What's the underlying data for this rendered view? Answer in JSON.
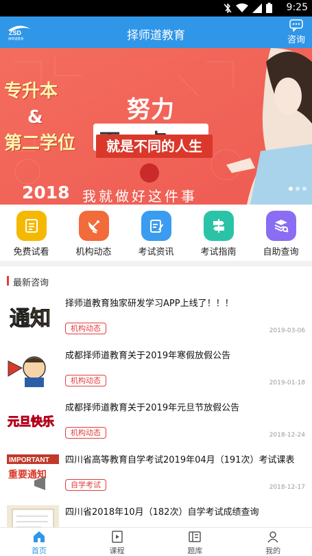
{
  "status_bar": {
    "time": "9:25",
    "icons": [
      "bluetooth-off-icon",
      "wifi-icon",
      "signal-icon",
      "battery-icon"
    ]
  },
  "header": {
    "title": "择师道教育",
    "consult_label": "咨询",
    "logo_text": "择师道教育",
    "brand_color": "#3096e8"
  },
  "banner": {
    "left_line1": "专升本",
    "left_line2": "&",
    "left_line3": "第二学位",
    "slogan_top": "努力",
    "slogan_main": "再一点",
    "slogan_sub": "就是不同的人生",
    "year": "2018",
    "script": "我就做好这件事",
    "seal_text": "ZSD",
    "active_slide": 0,
    "slide_count": 3
  },
  "quick_nav": [
    {
      "label": "免费试看",
      "icon": "video-doc-icon",
      "color": "#f5b800"
    },
    {
      "label": "机构动态",
      "icon": "satellite-dish-icon",
      "color": "#f26b3a"
    },
    {
      "label": "考试资讯",
      "icon": "edit-doc-icon",
      "color": "#3a9cf0"
    },
    {
      "label": "考试指南",
      "icon": "signpost-icon",
      "color": "#2bc3a8"
    },
    {
      "label": "自助查询",
      "icon": "layers-search-icon",
      "color": "#8a6df2"
    }
  ],
  "news": {
    "section_title": "最新咨询",
    "items": [
      {
        "title": "择师道教育独家研发学习APP上线了！！！",
        "tag": "机构动态",
        "date": "2019-03-06",
        "thumb": "notice-thumb"
      },
      {
        "title": "成都择师道教育关于2019年寒假放假公告",
        "tag": "机构动态",
        "date": "2019-01-18",
        "thumb": "megaphone-thumb"
      },
      {
        "title": "成都择师道教育关于2019年元旦节放假公告",
        "tag": "机构动态",
        "date": "2018-12-24",
        "thumb": "new-year-thumb"
      },
      {
        "title": "四川省高等教育自学考试2019年04月（191次）考试课表",
        "tag": "自学考试",
        "date": "2018-12-17",
        "thumb": "important-notice-thumb"
      },
      {
        "title": "四川省2018年10月（182次）自学考试成绩查询",
        "tag": "",
        "date": "",
        "thumb": "document-thumb"
      }
    ],
    "thumb_text": {
      "notice": "通知",
      "new_year": "元旦快乐",
      "important": "IMPORTANT",
      "important_sub": "重要通知"
    }
  },
  "tab_bar": [
    {
      "label": "首页",
      "icon": "home-icon",
      "active": true
    },
    {
      "label": "课程",
      "icon": "course-icon",
      "active": false
    },
    {
      "label": "题库",
      "icon": "question-bank-icon",
      "active": false
    },
    {
      "label": "我的",
      "icon": "profile-icon",
      "active": false
    }
  ]
}
